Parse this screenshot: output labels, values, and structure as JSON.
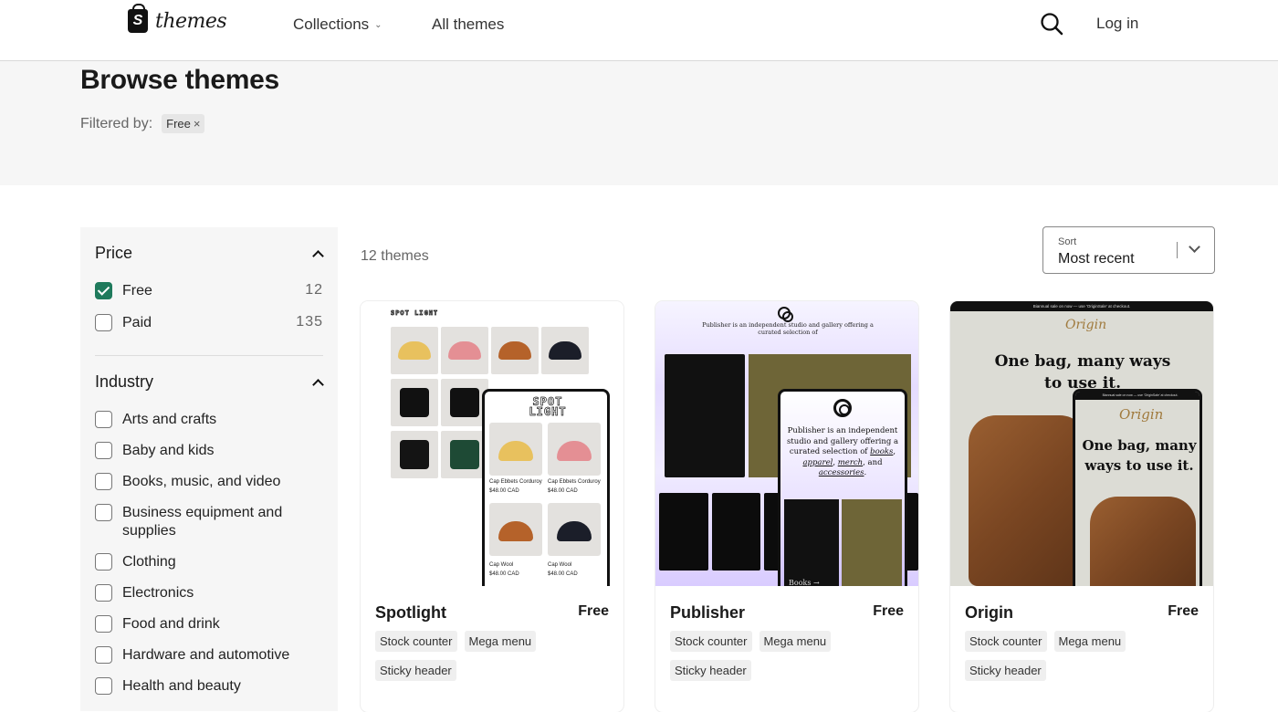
{
  "header": {
    "logo_text": "themes",
    "nav": [
      {
        "label": "Collections",
        "has_dropdown": true
      },
      {
        "label": "All themes",
        "has_dropdown": false
      }
    ],
    "search_icon": "search-icon",
    "login_label": "Log in"
  },
  "hero": {
    "title": "Browse themes",
    "filtered_by_label": "Filtered by:",
    "active_filters": [
      {
        "label": "Free",
        "remove_icon": "close-icon"
      }
    ]
  },
  "sidebar": {
    "price": {
      "title": "Price",
      "expanded": true,
      "options": [
        {
          "label": "Free",
          "count": "12",
          "checked": true
        },
        {
          "label": "Paid",
          "count": "135",
          "checked": false
        }
      ]
    },
    "industry": {
      "title": "Industry",
      "expanded": true,
      "options": [
        {
          "label": "Arts and crafts",
          "checked": false
        },
        {
          "label": "Baby and kids",
          "checked": false
        },
        {
          "label": "Books, music, and video",
          "checked": false
        },
        {
          "label": "Business equipment and supplies",
          "checked": false
        },
        {
          "label": "Clothing",
          "checked": false
        },
        {
          "label": "Electronics",
          "checked": false
        },
        {
          "label": "Food and drink",
          "checked": false
        },
        {
          "label": "Hardware and automotive",
          "checked": false
        },
        {
          "label": "Health and beauty",
          "checked": false
        }
      ]
    }
  },
  "results": {
    "count_label": "12 themes",
    "sort": {
      "label": "Sort",
      "value": "Most recent"
    }
  },
  "themes": [
    {
      "name": "Spotlight",
      "price": "Free",
      "tags": [
        "Stock counter",
        "Mega menu",
        "Sticky header"
      ],
      "preview": {
        "logo": "SPOT LIGHT",
        "products": [
          {
            "name": "Cap Ebbets Corduroy",
            "price": "$48.00 CAD"
          },
          {
            "name": "Cap Ebbets Corduroy",
            "price": "$48.00 CAD"
          },
          {
            "name": "Cap Wool",
            "price": "$48.00 CAD"
          },
          {
            "name": "Cap Wool",
            "price": "$48.00 CAD"
          }
        ]
      }
    },
    {
      "name": "Publisher",
      "price": "Free",
      "tags": [
        "Stock counter",
        "Mega menu",
        "Sticky header"
      ],
      "preview": {
        "headline_pre": "Publisher is an independent studio and gallery offering a curated selection of",
        "links": [
          "books",
          "apparel",
          "merch",
          "accessories"
        ],
        "cta": "Books →"
      }
    },
    {
      "name": "Origin",
      "price": "Free",
      "tags": [
        "Stock counter",
        "Mega menu",
        "Sticky header"
      ],
      "preview": {
        "announcement": "Biannual sale on now — use 'OriginSale' at checkout.",
        "brand": "Origin",
        "headline": "One bag, many ways to use it."
      }
    }
  ],
  "colors": {
    "accent_checkbox": "#1f7a5c",
    "hero_bg": "#f6f6f6",
    "tag_bg": "#efefef"
  }
}
